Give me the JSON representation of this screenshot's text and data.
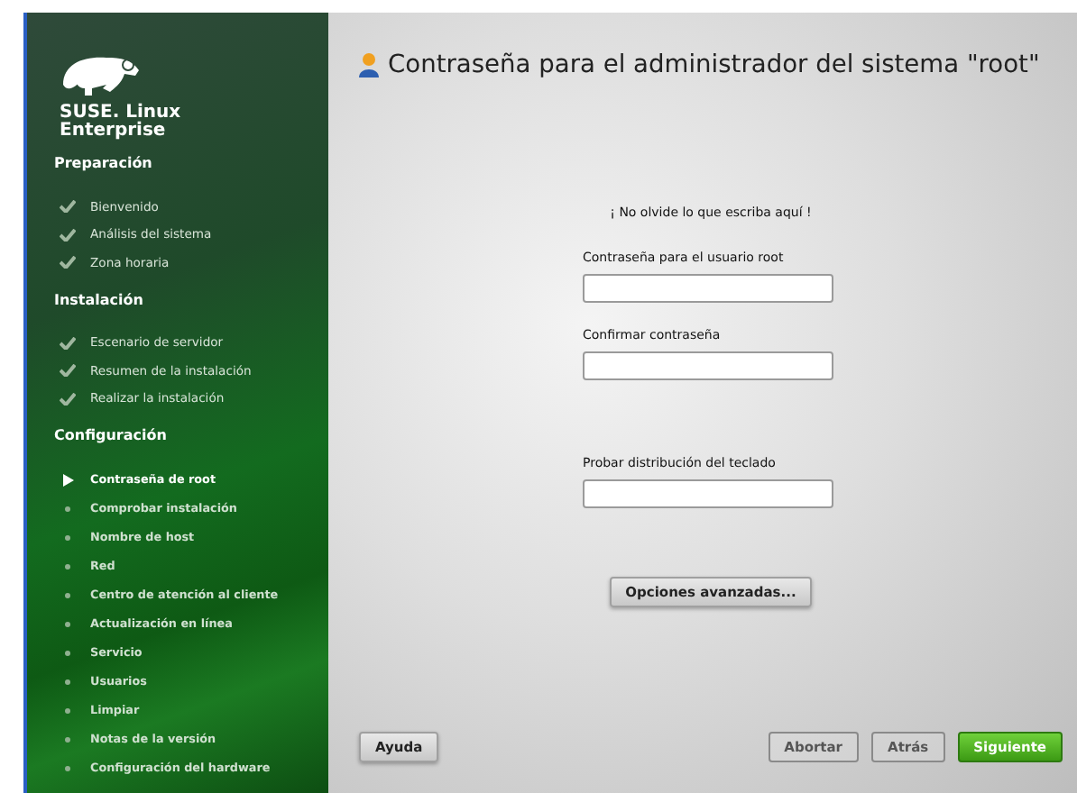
{
  "sidebar": {
    "product": "SUSE. Linux Enterprise",
    "sections": [
      {
        "title": "Preparación",
        "steps": [
          {
            "label": "Bienvenido",
            "kind": "done"
          },
          {
            "label": "Análisis del sistema",
            "kind": "done"
          },
          {
            "label": "Zona horaria",
            "kind": "done"
          }
        ]
      },
      {
        "title": "Instalación",
        "steps": [
          {
            "label": "Escenario de servidor",
            "kind": "done"
          },
          {
            "label": "Resumen de la instalación",
            "kind": "done"
          },
          {
            "label": "Realizar la instalación",
            "kind": "done"
          }
        ]
      },
      {
        "title": "Configuración",
        "steps": [
          {
            "label": "Contraseña de root",
            "kind": "current"
          },
          {
            "label": "Comprobar instalación",
            "kind": "pending"
          },
          {
            "label": "Nombre de host",
            "kind": "pending"
          },
          {
            "label": "Red",
            "kind": "pending"
          },
          {
            "label": "Centro de atención al cliente",
            "kind": "pending"
          },
          {
            "label": "Actualización en línea",
            "kind": "pending"
          },
          {
            "label": "Servicio",
            "kind": "pending"
          },
          {
            "label": "Usuarios",
            "kind": "pending"
          },
          {
            "label": "Limpiar",
            "kind": "pending"
          },
          {
            "label": "Notas de la versión",
            "kind": "pending"
          },
          {
            "label": "Configuración del hardware",
            "kind": "pending"
          }
        ]
      }
    ]
  },
  "main": {
    "title": "Contraseña para el administrador del sistema \"root\"",
    "message": "¡ No olvide lo que escriba aquí !",
    "fields": [
      {
        "label": "Contraseña para el usuario root"
      },
      {
        "label": "Confirmar contraseña"
      },
      {
        "label": "Probar distribución del teclado"
      }
    ],
    "advanced_button": "Opciones avanzadas..."
  },
  "buttons": [
    {
      "label": "Ayuda",
      "kind": "normal",
      "disabled": false
    },
    {
      "label": "Abortar",
      "kind": "normal",
      "disabled": true
    },
    {
      "label": "Atrás",
      "kind": "normal",
      "disabled": true
    },
    {
      "label": "Siguiente",
      "kind": "primary",
      "disabled": false
    }
  ]
}
